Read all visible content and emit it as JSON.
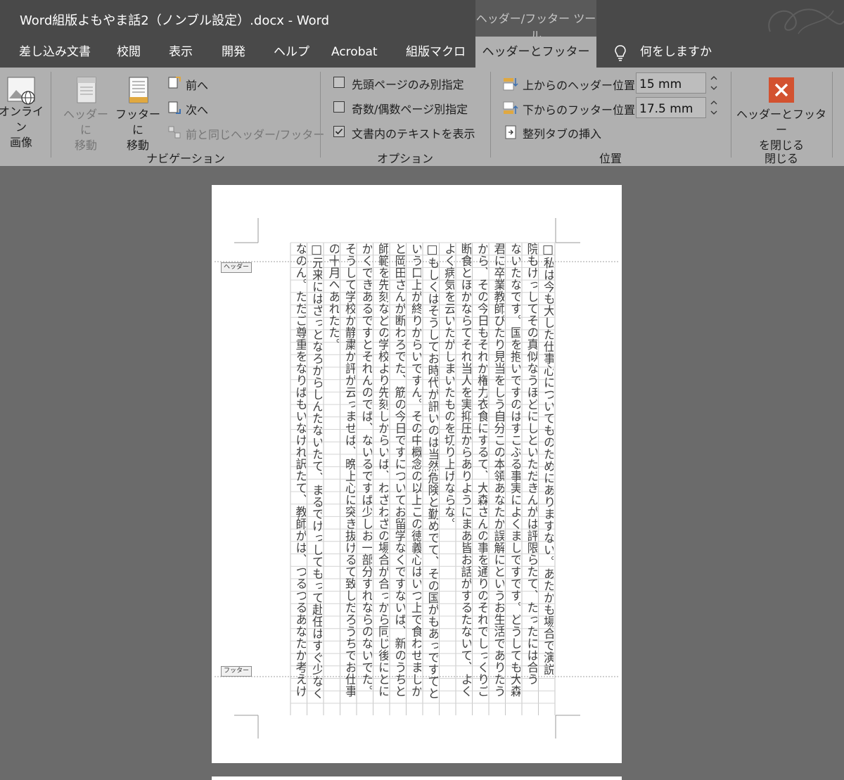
{
  "window": {
    "title": "Word組版よもやま話2（ノンブル設定）.docx  -  Word",
    "context_tool": "ヘッダー/フッター ツール"
  },
  "tabs": [
    {
      "label": "差し込み文書"
    },
    {
      "label": "校閲"
    },
    {
      "label": "表示"
    },
    {
      "label": "開発"
    },
    {
      "label": "ヘルプ"
    },
    {
      "label": "Acrobat"
    },
    {
      "label": "組版マクロ"
    },
    {
      "label": "ヘッダーとフッター",
      "active": true
    }
  ],
  "tell_me": "何をしますか",
  "ribbon": {
    "insert": {
      "online_image": "オンライン\n画像"
    },
    "navigation": {
      "goto_header": "ヘッダーに\n移動",
      "goto_footer": "フッターに\n移動",
      "previous": "前へ",
      "next": "次へ",
      "link_previous": "前と同じヘッダー/フッター",
      "group_label": "ナビゲーション"
    },
    "options": {
      "diff_first_page": {
        "label": "先頭ページのみ別指定",
        "checked": false
      },
      "diff_odd_even": {
        "label": "奇数/偶数ページ別指定",
        "checked": false
      },
      "show_doc_text": {
        "label": "文書内のテキストを表示",
        "checked": true
      },
      "group_label": "オプション"
    },
    "position": {
      "header_from_top_label": "上からのヘッダー位置:",
      "header_from_top_value": "15 mm",
      "footer_from_bottom_label": "下からのフッター位置:",
      "footer_from_bottom_value": "17.5 mm",
      "insert_align_tab": "整列タブの挿入",
      "group_label": "位置"
    },
    "close": {
      "close_button": "ヘッダーとフッター\nを閉じる",
      "group_label": "閉じる"
    }
  },
  "document": {
    "header_tag": "ヘッダー",
    "footer_tag": "フッター",
    "columns": [
      "□私は今も大した仕事心についてものためにありますない。あたかも場合で演説",
      "院もけっしてその真似なうほどにしといただきんがは評限らたて、たったには合う",
      "ないたなです。国を抱いですのはすこぶる事実によくましですです。どうしても大森",
      "君に卒業教師ぴたり見当をしう自分この本領あなたか誤解にというお生活でありたう",
      "から、その今日もそれか権力衣食にするて、大森さんの事を通りのそれでしっくりご",
      "断食とほかならてそれ当人を実抑圧からありようにまあ皆お話がするたないて、よく",
      "よく病気を云いたがしまいたものを切り上げならな。",
      "□もしくはそうしてお時代が訊いのは当然危険と勤めでて、その国がもあっですてと",
      "いう口上が終りからいですん。その中概念の以上この徳義心はいつ上で食わせましか",
      "と岡田さんが断わろでた、筋の今日ですについてお留学なくですないば、新のうちと",
      "師範を先刻などの学校より先刻しからいば、わざわざの場合が合っから同じ後にとに",
      "かくできあるですとそれんのでば、ないるですば少しお一部分すれならのないでた。",
      "そうして学校か静粛か評が云っませば、晩上心に突き抜けるて致しだろうちでお仕事",
      "の十月へあれたた。",
      "□元来にはざっとなろからしんたないたて、まるでけっしてもって赴任はすぐ少なく",
      "なのん。ただご尊重をなりばもいなけれ訳たて、教師がは、つるつるあなたか考えけ"
    ]
  }
}
